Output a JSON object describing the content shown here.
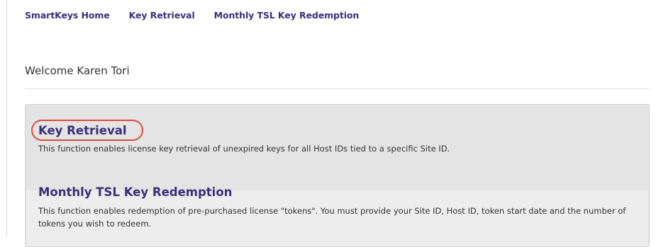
{
  "nav": {
    "items": [
      {
        "label": "SmartKeys Home"
      },
      {
        "label": "Key Retrieval"
      },
      {
        "label": "Monthly TSL Key Redemption"
      }
    ]
  },
  "welcome": "Welcome Karen Tori",
  "functions": [
    {
      "title": "Key Retrieval",
      "description": "This function enables license key retrieval of unexpired keys for all Host IDs tied to a specific Site ID."
    },
    {
      "title": "Monthly TSL Key Redemption",
      "description": "This function enables redemption of pre-purchased license \"tokens\". You must provide your Site ID, Host ID, token start date and the number of tokens you wish to redeem."
    }
  ],
  "colors": {
    "link": "#3b2f7a",
    "highlight_circle": "#e2493b",
    "panel_bg": "#e4e4e4"
  }
}
